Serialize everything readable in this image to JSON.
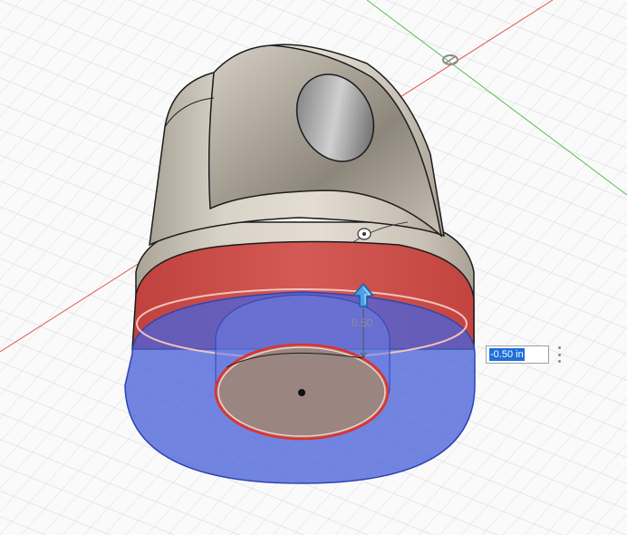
{
  "dimension": {
    "label": "0.50",
    "input_value": "-0.50 in"
  },
  "icons": {
    "drag_arrow": "up-arrow-icon",
    "menu": "vertical-ellipsis-icon",
    "origin": "origin-pivot-icon"
  },
  "colors": {
    "body": "#dcd6cc",
    "selected_face": "#c94d4a",
    "extrude_preview": "#4a63d8",
    "x_axis": "#e05555",
    "y_axis": "#55c055",
    "accent": "#1e6fd9"
  }
}
